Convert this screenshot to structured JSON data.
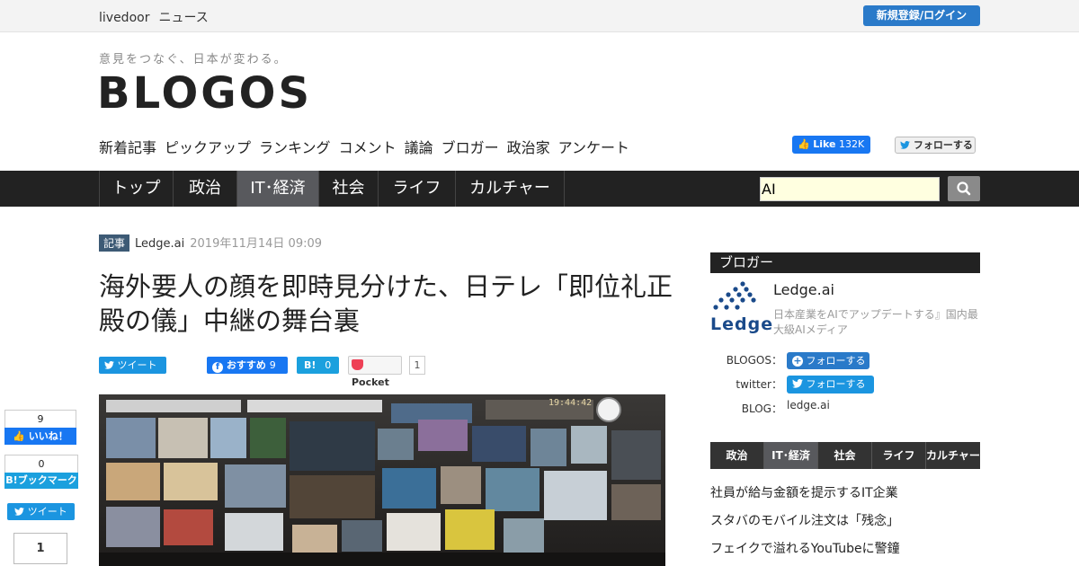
{
  "header": {
    "site_name": "livedoor",
    "site_section": "ニュース",
    "login_label": "新規登録/ログイン",
    "tagline": "意見をつなぐ、日本が変わる。",
    "logo": "BLOGOS",
    "nav": [
      "新着記事",
      "ピックアップ",
      "ランキング",
      "コメント",
      "議論",
      "ブロガー",
      "政治家",
      "アンケート"
    ],
    "fb_like_label": "Like",
    "fb_like_count": "132K",
    "twitter_follow_label": "フォローする"
  },
  "categories": [
    "トップ",
    "政治",
    "IT･経済",
    "社会",
    "ライフ",
    "カルチャー"
  ],
  "active_category": "IT･経済",
  "search": {
    "value": "AI"
  },
  "article": {
    "tag": "記事",
    "source": "Ledge.ai",
    "date": "2019年11月14日 09:09",
    "title": "海外要人の顔を即時見分けた、日テレ「即位礼正殿の儀」中継の舞台裏",
    "share": {
      "tweet_label": "ツイート",
      "fb_label": "おすすめ",
      "fb_count": "9",
      "hatena_label": "B!",
      "hatena_count": "0",
      "pocket_label": "Pocket",
      "pocket_count": "1"
    },
    "photo_clock": "19:44:42"
  },
  "side_share": {
    "like_count": "9",
    "like_label": "いいね！",
    "hatena_count": "0",
    "hatena_label": "B!ブックマーク",
    "tweet_label": "ツイート",
    "pocket_count": "1"
  },
  "blogger": {
    "header": "ブロガー",
    "logo_text": "Ledge",
    "name": "Ledge.ai",
    "description": "日本産業をAIでアップデートする』国内最大級AIメディア",
    "blogos_label": "BLOGOS：",
    "blogos_follow": "フォローする",
    "twitter_label": "twitter：",
    "twitter_follow": "フォローする",
    "blog_label": "BLOG：",
    "blog_url": "ledge.ai"
  },
  "ranking": {
    "tabs": [
      "政治",
      "IT･経済",
      "社会",
      "ライフ",
      "カルチャー"
    ],
    "active_tab": "IT･経済",
    "items": [
      "社員が給与金額を提示するIT企業",
      "スタバのモバイル注文は「残念」",
      "フェイクで溢れるYouTubeに警鐘"
    ]
  },
  "colors": {
    "category_bar": "#222222",
    "active_tab": "#58595d",
    "login_button": "#2a7ac9",
    "facebook": "#1877f2",
    "twitter": "#1b95e0",
    "hatena": "#1ba0de",
    "tag_background": "#3d5a75",
    "search_background": "#ffffe0"
  }
}
